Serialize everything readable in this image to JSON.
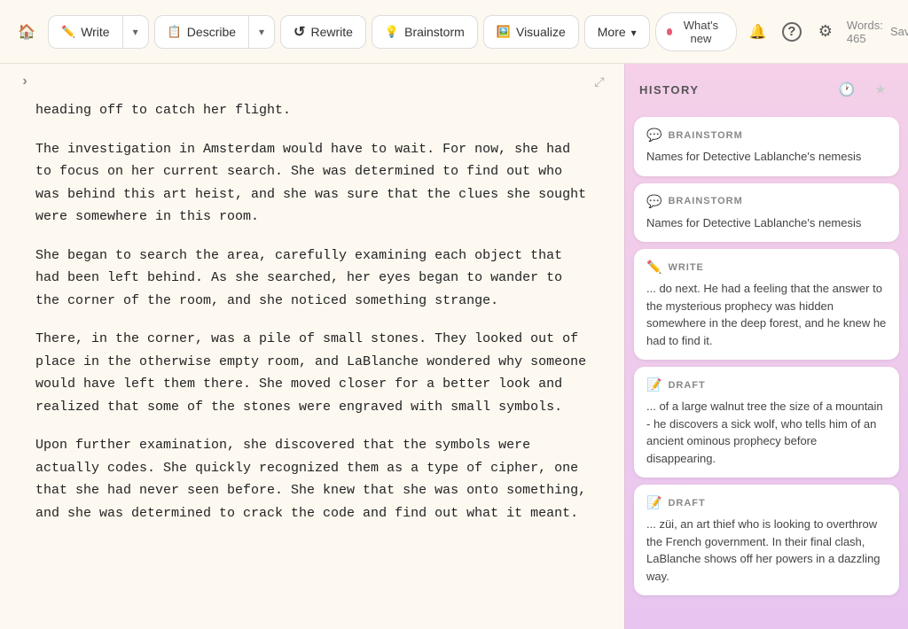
{
  "toolbar": {
    "home_icon": "home",
    "write_label": "Write",
    "describe_label": "Describe",
    "rewrite_label": "Rewrite",
    "brainstorm_label": "Brainstorm",
    "visualize_label": "Visualize",
    "more_label": "More",
    "whats_new_label": "What's new",
    "words_label": "Words: 465",
    "saved_label": "Saved"
  },
  "editor": {
    "paragraph1": "heading off to catch her flight.",
    "paragraph2": "The investigation in Amsterdam would have to wait. For now, she had to focus on her current search. She was determined to find out who was behind this art heist, and she was sure that the clues she sought were somewhere in this room.",
    "paragraph3": "She began to search the area, carefully examining each object that had been left behind. As she searched, her eyes began to wander to the corner of the room, and she noticed something strange.",
    "paragraph4": "There, in the corner, was a pile of small stones. They looked out of place in the otherwise empty room, and LaBlanche wondered why someone would have left them there. She moved closer for a better look and realized that some of the stones were engraved with small symbols.",
    "paragraph5": "Upon further examination, she discovered that the symbols were actually codes. She quickly recognized them as a type of cipher, one that she had never seen before. She knew that she was onto something, and she was determined to crack the code and find out what it meant."
  },
  "sidebar": {
    "title": "HISTORY",
    "clock_icon": "clock",
    "star_icon": "star",
    "items": [
      {
        "type": "BRAINSTORM",
        "icon": "brainstorm",
        "text": "Names for Detective Lablanche's nemesis"
      },
      {
        "type": "BRAINSTORM",
        "icon": "brainstorm",
        "text": "Names for Detective Lablanche's nemesis"
      },
      {
        "type": "WRITE",
        "icon": "write",
        "text": "... do next. He had a feeling that the answer to the mysterious prophecy was hidden somewhere in the deep forest, and he knew he had to find it."
      },
      {
        "type": "DRAFT",
        "icon": "draft",
        "text": "... of a large walnut tree the size of a mountain - he discovers a sick wolf, who tells him of an ancient ominous prophecy before disappearing."
      },
      {
        "type": "DRAFT",
        "icon": "draft",
        "text": "... züi, an art thief who is looking to overthrow the French government. In their final clash, LaBlanche shows off her powers in a dazzling way."
      }
    ]
  }
}
